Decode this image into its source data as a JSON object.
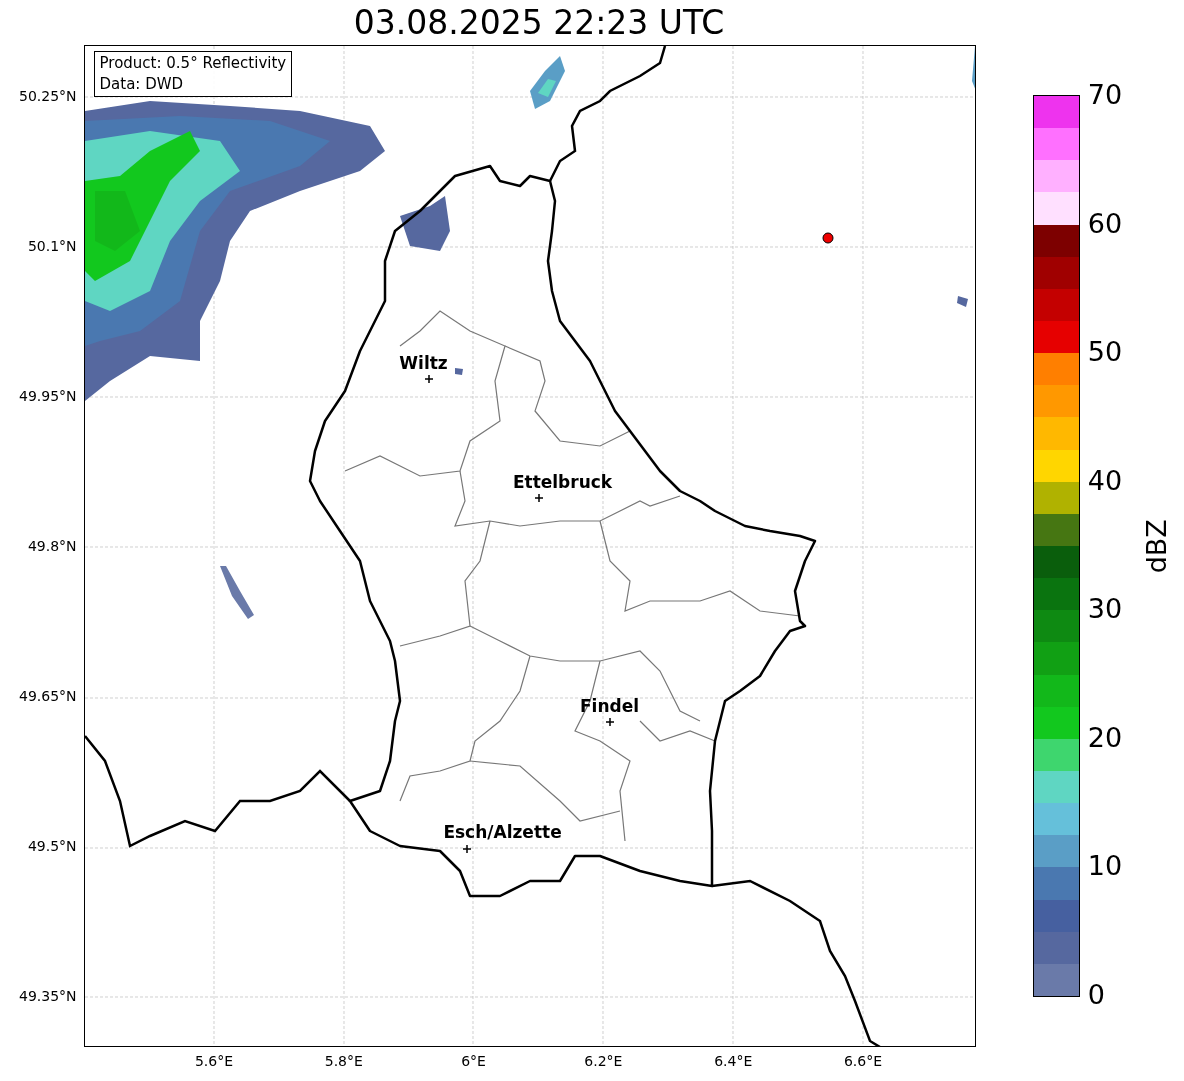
{
  "title": "03.08.2025 22:23 UTC",
  "info_box": [
    "Product: 0.5° Reflectivity",
    "Data: DWD"
  ],
  "cities": [
    {
      "name": "Wiltz"
    },
    {
      "name": "Ettelbruck"
    },
    {
      "name": "Findel"
    },
    {
      "name": "Esch/Alzette"
    }
  ],
  "lat_ticks": [
    "50.25°N",
    "50.1°N",
    "49.95°N",
    "49.8°N",
    "49.65°N",
    "49.5°N",
    "49.35°N"
  ],
  "lon_ticks": [
    "5.6°E",
    "5.8°E",
    "6°E",
    "6.2°E",
    "6.4°E",
    "6.6°E"
  ],
  "colorbar": {
    "label": "dBZ",
    "ticks": [
      "70",
      "60",
      "50",
      "40",
      "30",
      "20",
      "10",
      "0"
    ],
    "segments": [
      {
        "color": "#6a7aa9"
      },
      {
        "color": "#56689f"
      },
      {
        "color": "#4660a0"
      },
      {
        "color": "#4a78b0"
      },
      {
        "color": "#5a9ec6"
      },
      {
        "color": "#65c0da"
      },
      {
        "color": "#5fd6c2"
      },
      {
        "color": "#3ed66e"
      },
      {
        "color": "#12c81e"
      },
      {
        "color": "#12b81a"
      },
      {
        "color": "#11a014"
      },
      {
        "color": "#0e8a12"
      },
      {
        "color": "#0a740f"
      },
      {
        "color": "#0a5e0c"
      },
      {
        "color": "#467612"
      },
      {
        "color": "#b0b200"
      },
      {
        "color": "#ffd600"
      },
      {
        "color": "#ffb800"
      },
      {
        "color": "#ff9800"
      },
      {
        "color": "#ff7f00"
      },
      {
        "color": "#e60000"
      },
      {
        "color": "#c40000"
      },
      {
        "color": "#a00000"
      },
      {
        "color": "#7d0000"
      },
      {
        "color": "#ffe0ff"
      },
      {
        "color": "#ffb0ff"
      },
      {
        "color": "#ff70ff"
      },
      {
        "color": "#ee33ee"
      }
    ]
  }
}
